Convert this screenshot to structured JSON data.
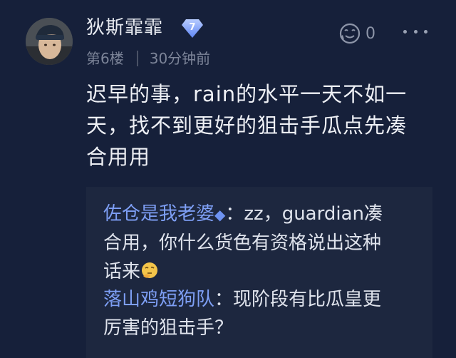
{
  "post": {
    "username": "狄斯霏霏",
    "level": "7",
    "floor": "第6楼",
    "time": "30分钟前",
    "like_count": "0",
    "content_line1": "迟早的事，rain的水平一天不如一",
    "content_line2": "天，找不到更好的狙击手瓜点先凑",
    "content_line3": "合用用"
  },
  "replies": [
    {
      "name": "佐仓是我老婆",
      "badge": "◆",
      "line1_rest": "：zz，guardian凑",
      "line2": "合用，你什么货色有资格说出这种",
      "line3": "话来"
    },
    {
      "name": "落山鸡短狗队",
      "line1_rest": "：现阶段有比瓜皇更",
      "line2": "厉害的狙击手？"
    }
  ],
  "colors": {
    "background": "#16203a",
    "reply_background": "#1d273f",
    "reply_name": "#7e9ff5",
    "meta": "#7d8599"
  }
}
